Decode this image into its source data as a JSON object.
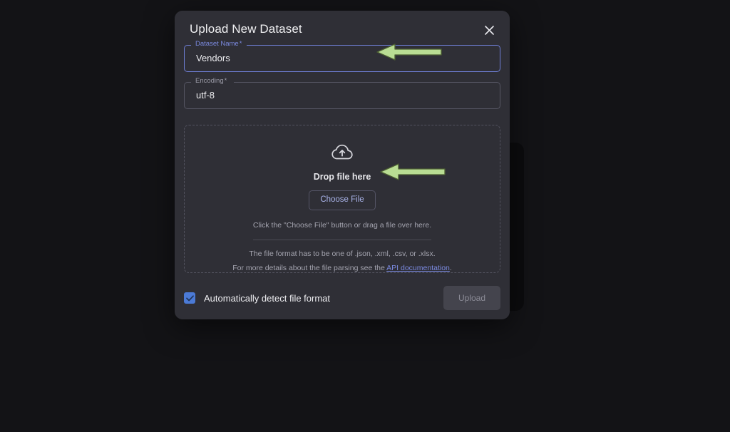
{
  "dialog": {
    "title": "Upload New Dataset",
    "close_icon": "close-icon"
  },
  "fields": [
    {
      "label": "Dataset Name",
      "required_mark": "*",
      "value": "Vendors",
      "placeholder": "",
      "focused": true
    },
    {
      "label": "Encoding",
      "required_mark": "*",
      "value": "utf-8",
      "placeholder": "",
      "focused": false
    }
  ],
  "dropzone": {
    "icon": "cloud-upload-icon",
    "title": "Drop file here",
    "choose_file_label": "Choose File",
    "hint": "Click the \"Choose File\" button or drag a file over here.",
    "format_note": "The file format has to be one of .json, .xml, .csv, or .xlsx.",
    "parsing_note_prefix": "For more details about the file parsing see the ",
    "parsing_note_link": "API documentation",
    "parsing_note_suffix": "."
  },
  "footer": {
    "checkbox_label": "Automatically detect file format",
    "checkbox_checked": true,
    "upload_label": "Upload",
    "upload_disabled": true
  },
  "annotations": [
    {
      "name": "arrow-to-dataset-name-field",
      "direction": "left"
    },
    {
      "name": "arrow-to-choose-file-button",
      "direction": "left"
    }
  ],
  "colors": {
    "page_background": "#131316",
    "dialog_background": "#2f2f36",
    "accent_blue": "#7b8ae0",
    "checkbox_blue": "#4b7ad6",
    "annotation_green": "#b9dd93",
    "annotation_green_outline": "#4c5e33"
  }
}
